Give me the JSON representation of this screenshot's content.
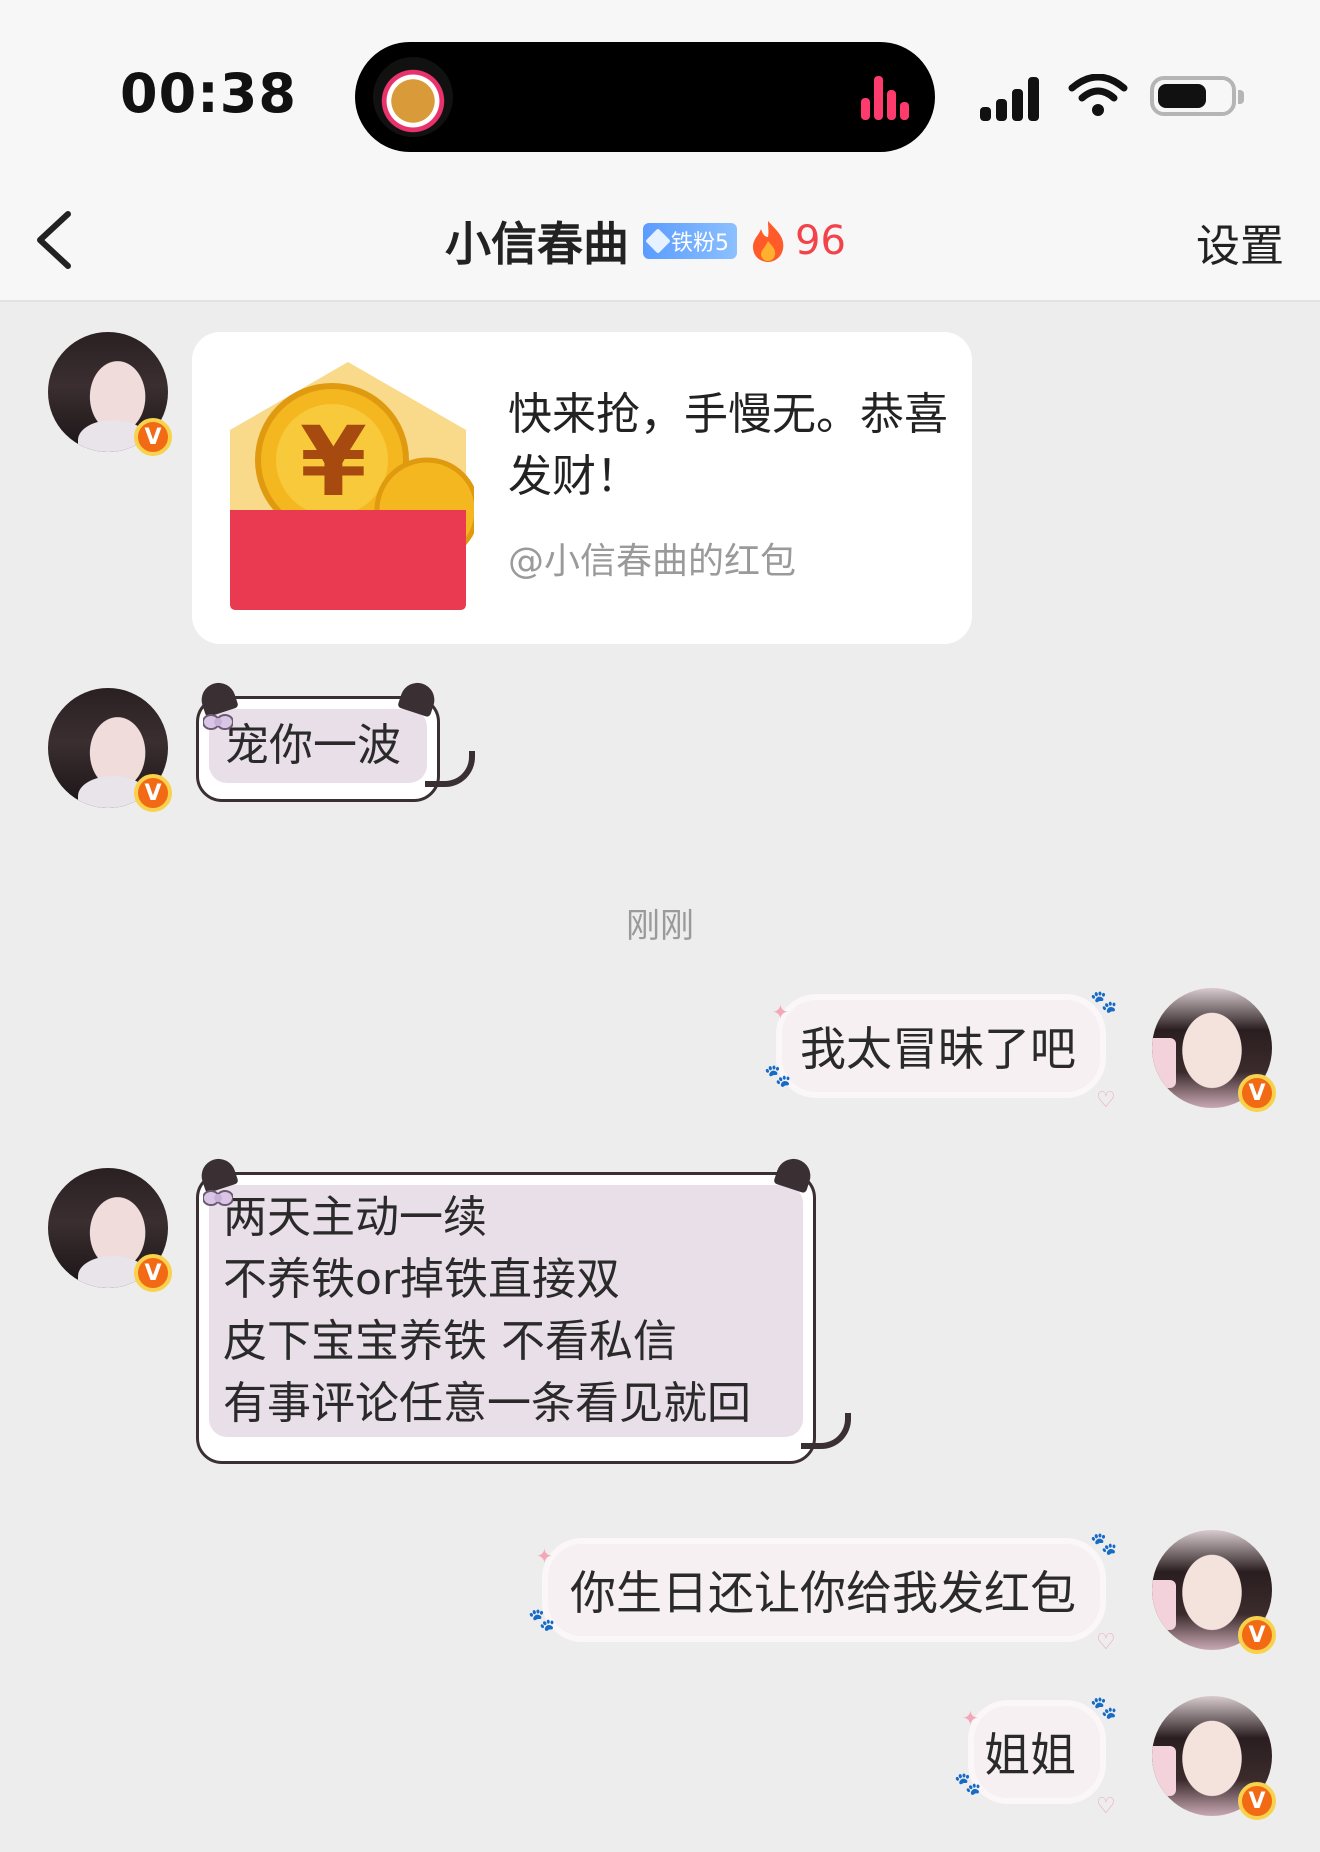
{
  "status_bar": {
    "time": "00:38",
    "icons": [
      "island-avatar-icon",
      "audio-wave-icon",
      "signal-icon",
      "wifi-icon",
      "battery-icon"
    ]
  },
  "nav": {
    "back_icon": "chevron-left-icon",
    "title": "小信春曲",
    "fan_badge": "铁粉5",
    "fire_count": "96",
    "settings_label": "设置"
  },
  "messages": {
    "red_packet": {
      "text": "快来抢，手慢无。恭喜发财！",
      "from": "@小信春曲的红包"
    },
    "m1": "宠你一波",
    "timestamp": "刚刚",
    "m2": "我太冒昧了吧",
    "m3_lines": [
      "两天主动一续",
      "不养铁or掉铁直接双",
      "皮下宝宝养铁 不看私信",
      "有事评论任意一条看见就回"
    ],
    "m4": "你生日还让你给我发红包",
    "m5": "姐姐"
  },
  "avatar_badge": "V",
  "colors": {
    "accent_red": "#f2434a",
    "badge_blue": "#5a9cff",
    "verified_orange": "#f26a13",
    "bubble_lilac": "#e9dfe8"
  }
}
